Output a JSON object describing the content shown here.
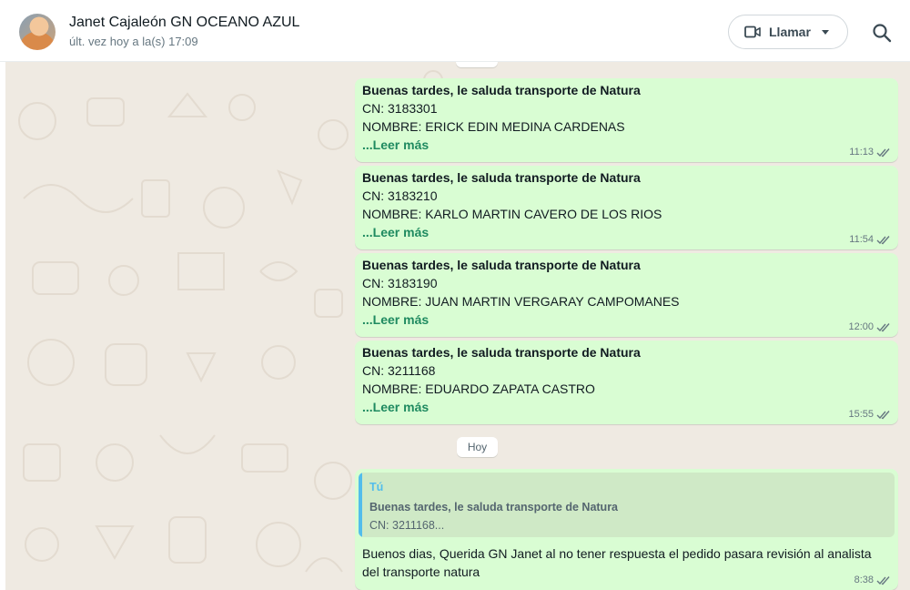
{
  "header": {
    "contact_name": "Janet Cajaleón GN OCEANO AZUL",
    "status": "últ. vez hoy a la(s) 17:09",
    "call_label": "Llamar",
    "icons": [
      "video-camera-icon",
      "chevron-down-icon",
      "search-icon"
    ]
  },
  "colors": {
    "outgoing_bubble": "#d9fdd3",
    "chat_background": "#efeae2",
    "read_more": "#1f8a60",
    "quote_accent": "#53bdeb"
  },
  "messages": [
    {
      "title": "Buenas tardes, le saluda transporte de Natura",
      "cn": "CN:   3183301",
      "nombre": "NOMBRE:  ERICK EDIN MEDINA CARDENAS",
      "read_more": "...Leer más",
      "time": "11:13"
    },
    {
      "title": "Buenas tardes, le saluda transporte de Natura",
      "cn": "CN:  3183210",
      "nombre": "NOMBRE:  KARLO MARTIN CAVERO DE LOS RIOS",
      "read_more": "...Leer más",
      "time": "11:54"
    },
    {
      "title": "Buenas tardes, le saluda transporte de Natura",
      "cn": "CN:   3183190",
      "nombre": "NOMBRE:  JUAN MARTIN VERGARAY CAMPOMANES",
      "read_more": "...Leer más",
      "time": "12:00"
    },
    {
      "title": "Buenas tardes, le saluda transporte de Natura",
      "cn": "CN: 3211168",
      "nombre": "NOMBRE: EDUARDO ZAPATA CASTRO",
      "read_more": "...Leer más",
      "time": "15:55"
    }
  ],
  "date_divider": "Hoy",
  "reply": {
    "quote_author": "Tú",
    "quote_title": "Buenas tardes, le saluda transporte de Natura",
    "quote_text": "CN: 3211168...",
    "text": "Buenos dias, Querida GN Janet al no tener respuesta  el pedido pasara revisión al analista del transporte natura",
    "time": "8:38"
  }
}
